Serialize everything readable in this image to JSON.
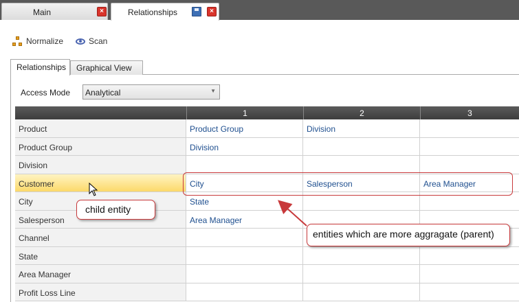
{
  "doc_tabs": {
    "main_label": "Main",
    "relationships_label": "Relationships",
    "close_glyph": "×"
  },
  "toolbar": {
    "normalize_label": "Normalize",
    "normalize_icon": "hierarchy-icon",
    "scan_label": "Scan",
    "scan_icon": "eye-icon"
  },
  "inner_tabs": {
    "relationships": "Relationships",
    "graphical_view": "Graphical View"
  },
  "access_mode": {
    "label": "Access Mode",
    "value": "Analytical"
  },
  "grid": {
    "columns": [
      "",
      "1",
      "2",
      "3"
    ],
    "rows": [
      {
        "name": "Product",
        "c1": "Product Group",
        "c2": "Division",
        "c3": ""
      },
      {
        "name": "Product Group",
        "c1": "Division",
        "c2": "",
        "c3": ""
      },
      {
        "name": "Division",
        "c1": "",
        "c2": "",
        "c3": ""
      },
      {
        "name": "Customer",
        "c1": "City",
        "c2": "Salesperson",
        "c3": "Area Manager"
      },
      {
        "name": "City",
        "c1": "State",
        "c2": "",
        "c3": ""
      },
      {
        "name": "Salesperson",
        "c1": "Area Manager",
        "c2": "",
        "c3": ""
      },
      {
        "name": "Channel",
        "c1": "",
        "c2": "",
        "c3": ""
      },
      {
        "name": "State",
        "c1": "",
        "c2": "",
        "c3": ""
      },
      {
        "name": "Area Manager",
        "c1": "",
        "c2": "",
        "c3": ""
      },
      {
        "name": "Profit Loss Line",
        "c1": "",
        "c2": "",
        "c3": ""
      }
    ],
    "selected_row": "Customer"
  },
  "annotations": {
    "child": "child entity",
    "parent": "entities which are more aggragate (parent)",
    "color": "#c8393b"
  }
}
